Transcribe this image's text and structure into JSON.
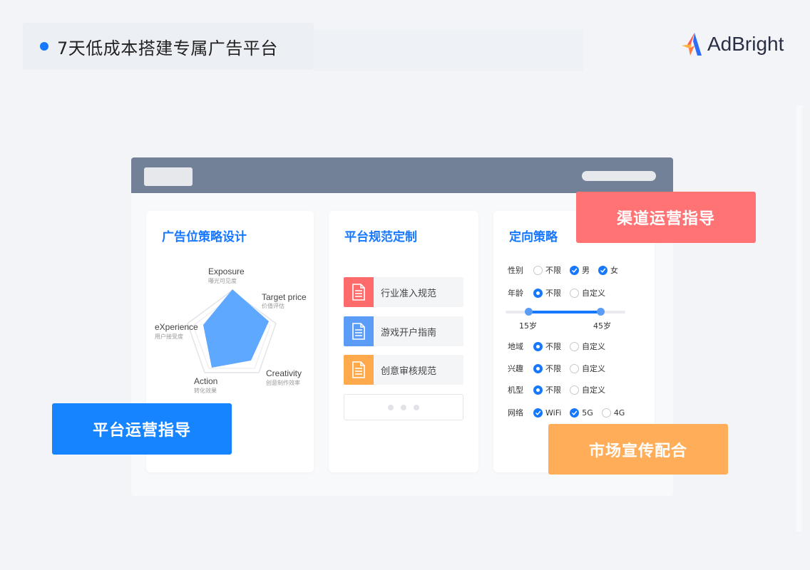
{
  "header": {
    "title": "7天低成本搭建专属广告平台",
    "logo_text": "AdBright"
  },
  "cards": {
    "ad_strategy": {
      "title": "广告位策略设计",
      "radar": {
        "exposure": {
          "en": "Exposure",
          "cn": "曝光可见度"
        },
        "target_price": {
          "en": "Target price",
          "cn": "价值评估"
        },
        "creativity": {
          "en": "Creativity",
          "cn": "创意制作效率"
        },
        "action": {
          "en": "Action",
          "cn": "转化效果"
        },
        "experience": {
          "en": "eXperience",
          "cn": "用户接受度"
        }
      }
    },
    "platform_spec": {
      "title": "平台规范定制",
      "docs": [
        {
          "label": "行业准入规范",
          "color": "#ff6b6b"
        },
        {
          "label": "游戏开户指南",
          "color": "#5b9cf6"
        },
        {
          "label": "创意审核规范",
          "color": "#ffa94d"
        }
      ]
    },
    "targeting": {
      "title": "定向策略",
      "gender": {
        "label": "性别",
        "opts": [
          "不限",
          "男",
          "女"
        ]
      },
      "age": {
        "label": "年龄",
        "opts": [
          "不限",
          "自定义"
        ],
        "min_label": "15岁",
        "max_label": "45岁",
        "min": 15,
        "max": 45
      },
      "region": {
        "label": "地域",
        "opts": [
          "不限",
          "自定义"
        ]
      },
      "interest": {
        "label": "兴趣",
        "opts": [
          "不限",
          "自定义"
        ]
      },
      "device": {
        "label": "机型",
        "opts": [
          "不限",
          "自定义"
        ]
      },
      "network": {
        "label": "网络",
        "opts": [
          "WiFi",
          "5G",
          "4G"
        ]
      }
    }
  },
  "tags": {
    "channel": "渠道运营指导",
    "platform": "平台运营指导",
    "market": "市场宣传配合"
  },
  "colors": {
    "primary": "#1677ff",
    "header_bar": "#728198",
    "red_tag": "#ff7375",
    "blue_tag": "#1683ff",
    "orange_tag": "#ffad58"
  }
}
